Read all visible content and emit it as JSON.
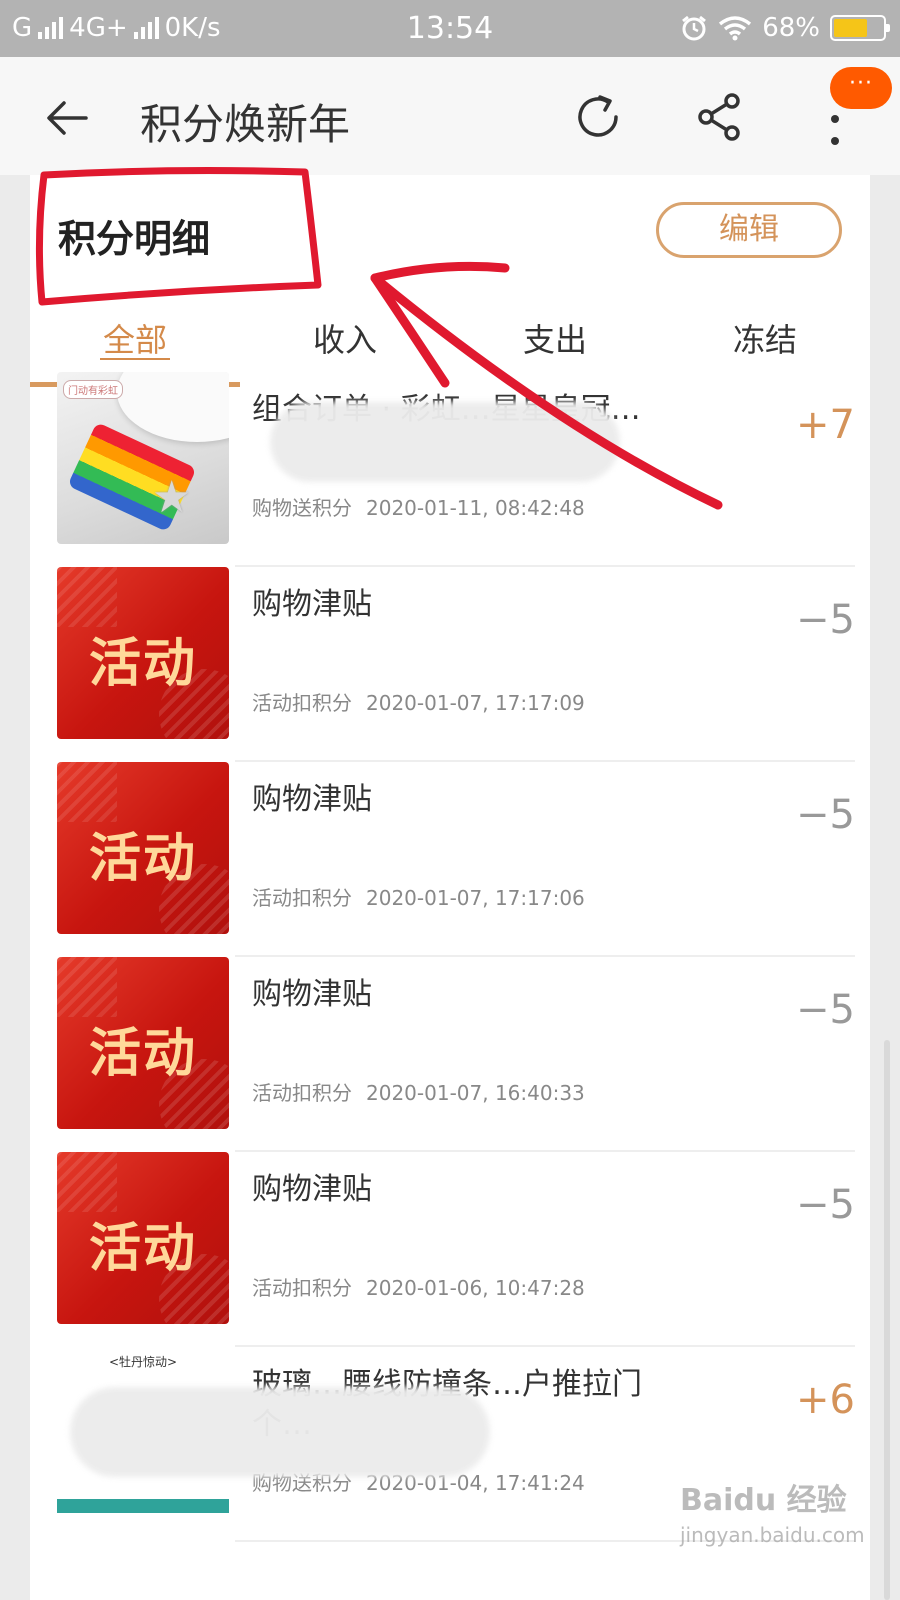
{
  "status_bar": {
    "carrier": "G",
    "network": "4G+",
    "speed": "0K/s",
    "time": "13:54",
    "battery": "68%",
    "battery_level": 0.68
  },
  "nav": {
    "title": "积分焕新年",
    "more_badge": "···",
    "icons": [
      "back-arrow-icon",
      "refresh-icon",
      "share-icon",
      "more-icon"
    ]
  },
  "section": {
    "title": "积分明细",
    "edit_label": "编辑"
  },
  "tabs": [
    {
      "label": "全部",
      "active": true
    },
    {
      "label": "收入",
      "active": false
    },
    {
      "label": "支出",
      "active": false
    },
    {
      "label": "冻结",
      "active": false
    }
  ],
  "records": [
    {
      "name": "组合订单 · 彩虹…星星皇冠…",
      "type": "购物送积分",
      "time": "2020-01-11, 08:42:48",
      "points": "+7"
    },
    {
      "name": "购物津贴",
      "thumb_text": "活动",
      "type": "活动扣积分",
      "time": "2020-01-07, 17:17:09",
      "points": "−5"
    },
    {
      "name": "购物津贴",
      "thumb_text": "活动",
      "type": "活动扣积分",
      "time": "2020-01-07, 17:17:06",
      "points": "−5"
    },
    {
      "name": "购物津贴",
      "thumb_text": "活动",
      "type": "活动扣积分",
      "time": "2020-01-07, 16:40:33",
      "points": "−5"
    },
    {
      "name": "购物津贴",
      "thumb_text": "活动",
      "type": "活动扣积分",
      "time": "2020-01-06, 10:47:28",
      "points": "−5"
    },
    {
      "name": "玻璃…腰线防撞条…户推拉门个…",
      "thumb_caption": "<牡丹惊动>",
      "type": "购物送积分",
      "time": "2020-01-04, 17:41:24",
      "points": "+6"
    }
  ],
  "colors": {
    "accent": "#d4935a",
    "badge": "#ff5a00",
    "activity_red": "#c7150f",
    "annotation_red": "#e0192f"
  },
  "watermark": {
    "main": "Baidu 经验",
    "sub": "jingyan.baidu.com"
  }
}
